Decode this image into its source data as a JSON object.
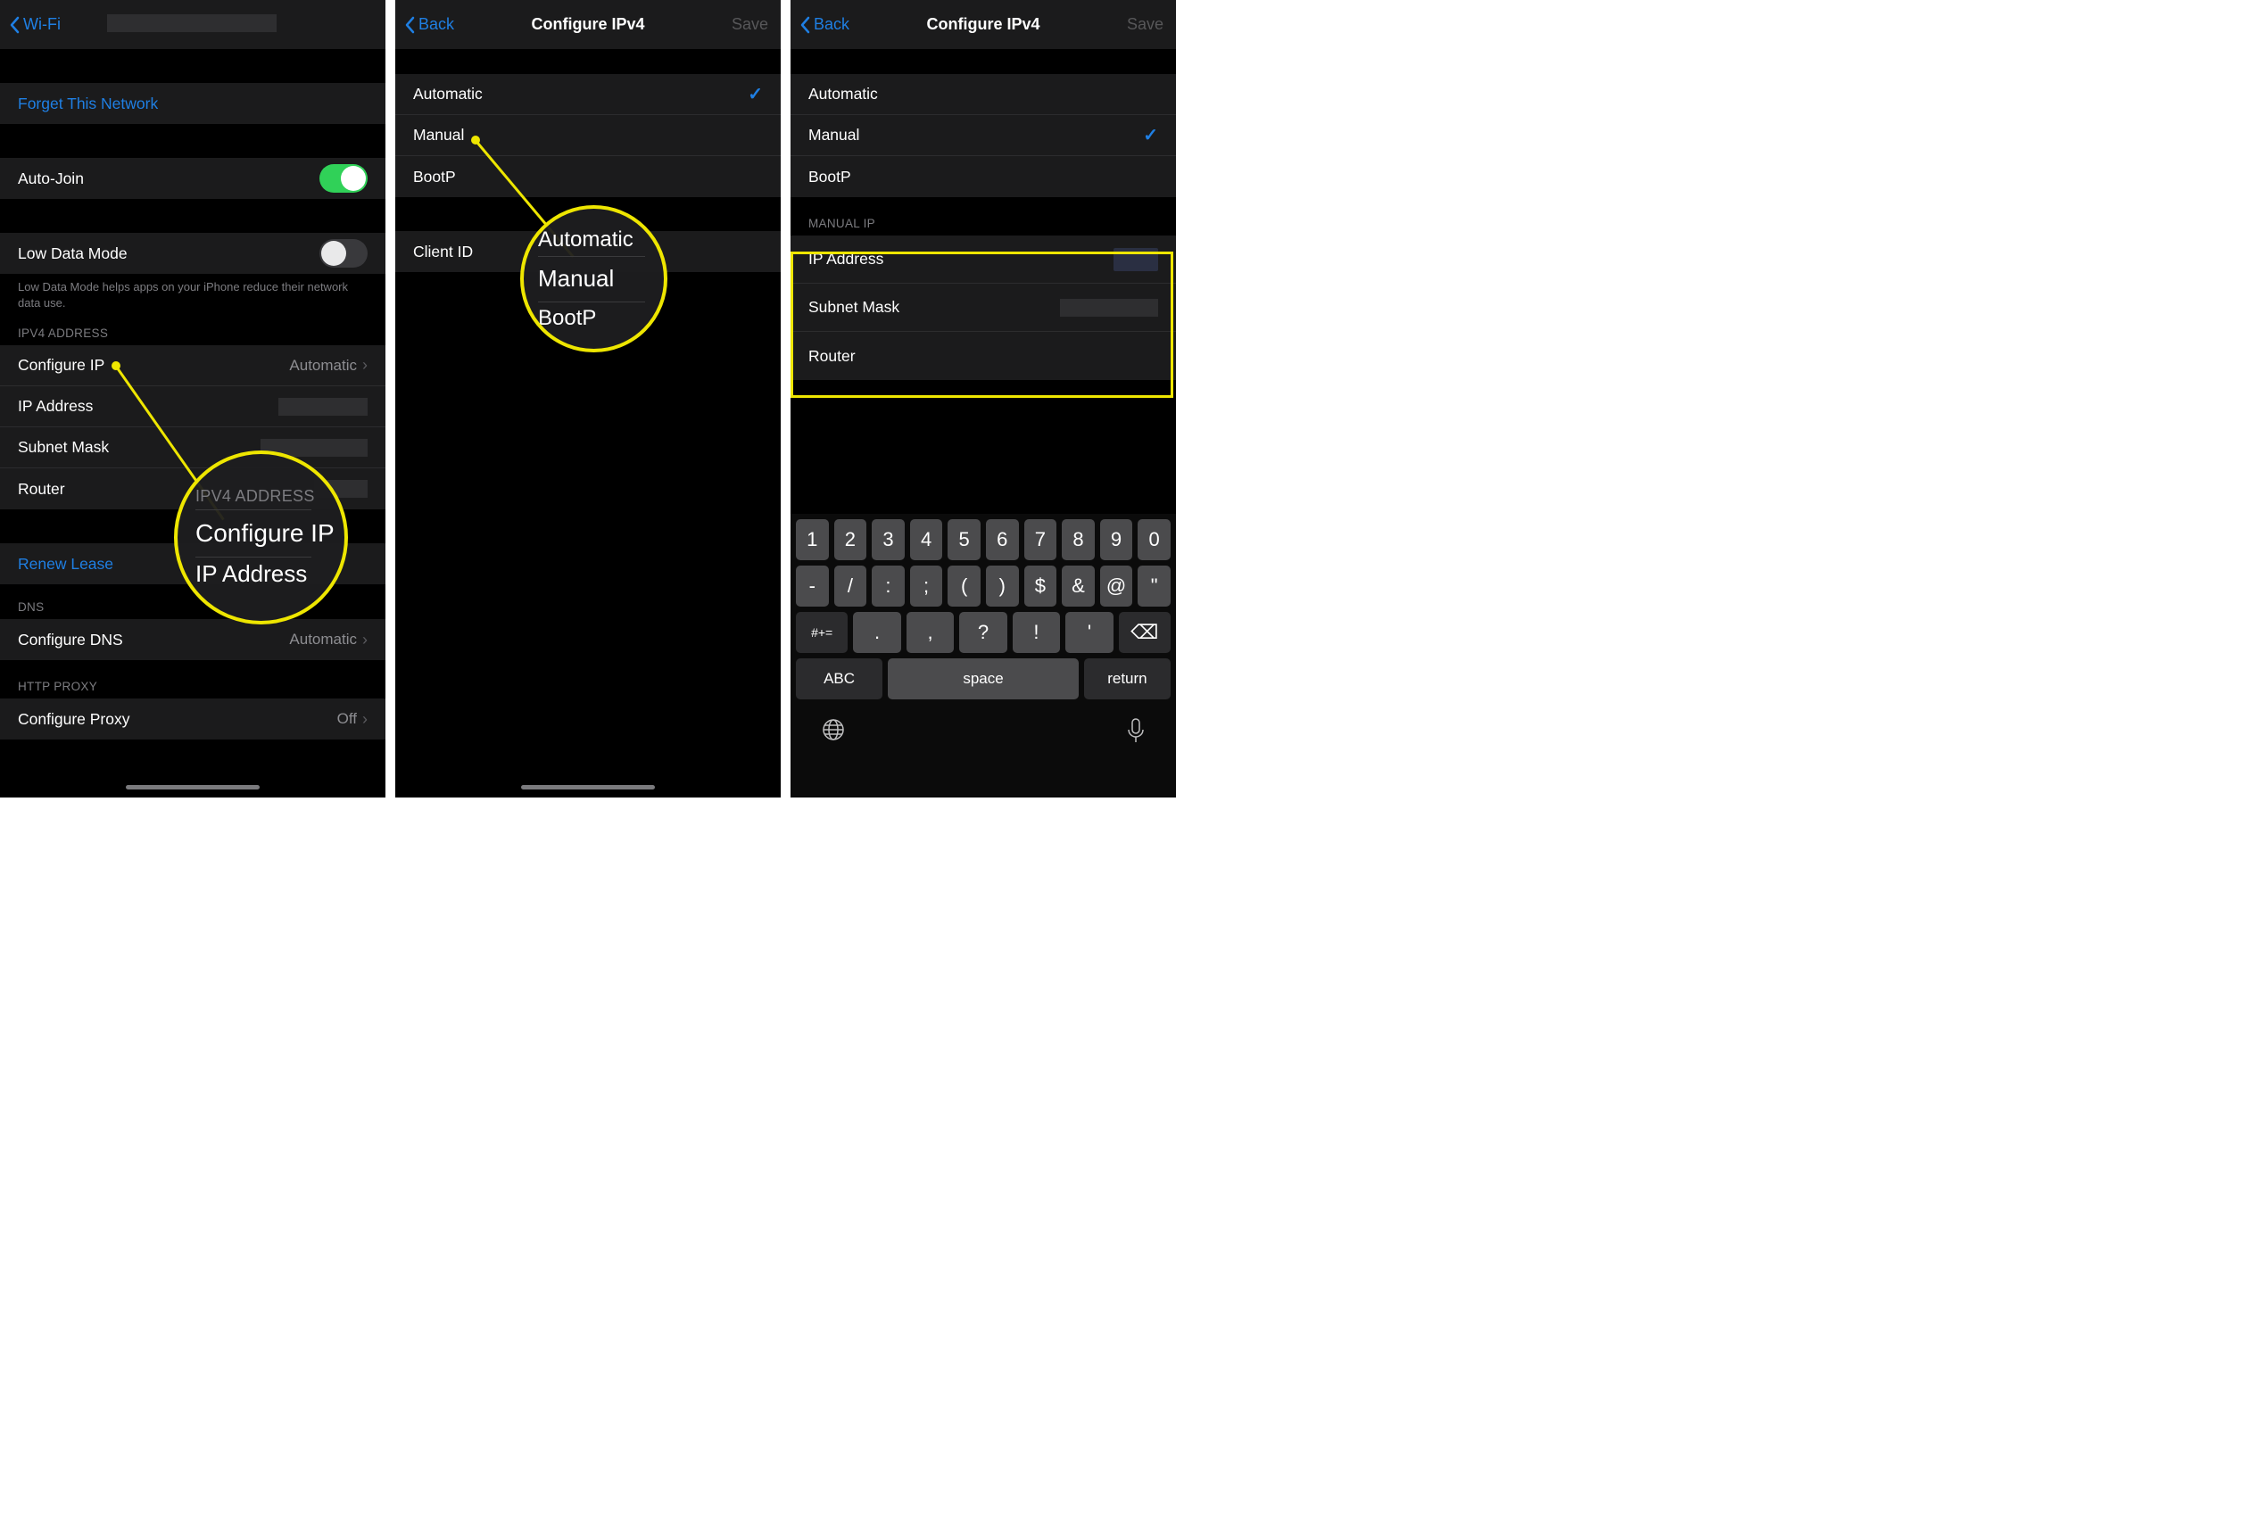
{
  "s1": {
    "nav": {
      "back": "Wi-Fi"
    },
    "rows": {
      "forget": "Forget This Network",
      "autojoin": "Auto-Join",
      "lowdata": "Low Data Mode",
      "lowdata_desc": "Low Data Mode helps apps on your iPhone reduce their network data use.",
      "ipv4_header": "IPV4 ADDRESS",
      "configure_ip": "Configure IP",
      "configure_ip_val": "Automatic",
      "ip_address": "IP Address",
      "subnet": "Subnet Mask",
      "router": "Router",
      "renew": "Renew Lease",
      "dns_header": "DNS",
      "configure_dns": "Configure DNS",
      "configure_dns_val": "Automatic",
      "proxy_header": "HTTP PROXY",
      "configure_proxy": "Configure Proxy",
      "configure_proxy_val": "Off"
    },
    "anno": {
      "t1": "IPV4 ADDRESS",
      "t2": "Configure IP",
      "t3": "IP Address"
    }
  },
  "s2": {
    "nav": {
      "back": "Back",
      "title": "Configure IPv4",
      "save": "Save"
    },
    "rows": {
      "automatic": "Automatic",
      "manual": "Manual",
      "bootp": "BootP",
      "clientid": "Client ID"
    },
    "anno": {
      "t1": "Automatic",
      "t2": "Manual",
      "t3": "BootP"
    }
  },
  "s3": {
    "nav": {
      "back": "Back",
      "title": "Configure IPv4",
      "save": "Save"
    },
    "rows": {
      "automatic": "Automatic",
      "manual": "Manual",
      "bootp": "BootP",
      "manual_header": "MANUAL IP",
      "ip": "IP Address",
      "subnet": "Subnet Mask",
      "router": "Router"
    },
    "kbd": {
      "r1": [
        "1",
        "2",
        "3",
        "4",
        "5",
        "6",
        "7",
        "8",
        "9",
        "0"
      ],
      "r2": [
        "-",
        "/",
        ":",
        ";",
        "(",
        ")",
        "$",
        "&",
        "@",
        "\""
      ],
      "r3": {
        "sym": "#+=",
        "punct": [
          ".",
          ",",
          "?",
          "!",
          "'"
        ],
        "del": "⌫"
      },
      "r4": {
        "abc": "ABC",
        "space": "space",
        "ret": "return"
      }
    }
  }
}
